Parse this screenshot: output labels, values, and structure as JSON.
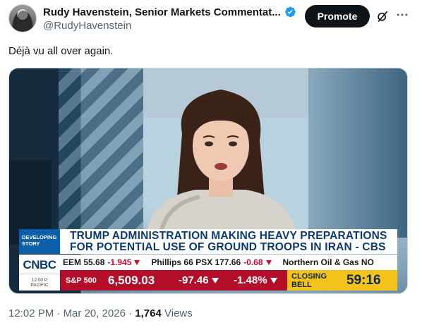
{
  "author": {
    "display_name": "Rudy Havenstein, Senior Markets Commentat...",
    "handle": "@RudyHavenstein",
    "verified_color": "#1d9bf0"
  },
  "actions": {
    "promote_label": "Promote",
    "grok_icon": "grok-icon",
    "more_icon": "more-icon"
  },
  "tweet": {
    "text": "Déjà vu all over again."
  },
  "media": {
    "category": "DEVELOPING STORY",
    "headline_line1": "TRUMP ADMINISTRATION MAKING HEAVY PREPARATIONS",
    "headline_line2": "FOR POTENTIAL USE OF GROUND TROOPS IN IRAN - CBS",
    "network": "CNBC",
    "local_time": "12:00 P",
    "timezone": "PACIFIC",
    "ticker": [
      {
        "symbol": "EEM 55.68",
        "change": "-1.945"
      },
      {
        "symbol": "Phillips 66 PSX 177.66",
        "change": "-0.68"
      },
      {
        "symbol": "Northern Oil & Gas NO",
        "change": ""
      }
    ],
    "market": {
      "label": "S&P 500",
      "value": "6,509.03",
      "change": "-97.46",
      "percent": "-1.48%"
    },
    "closing": {
      "label": "CLOSING BELL",
      "countdown": "59:16"
    },
    "colors": {
      "headline_blue": "#0b3a73",
      "market_red": "#b30f2a",
      "closing_yellow": "#f5c21b"
    }
  },
  "meta": {
    "time": "12:02 PM",
    "separator": " · ",
    "date": "Mar 20, 2026",
    "views_count": "1,764",
    "views_label": " Views"
  }
}
